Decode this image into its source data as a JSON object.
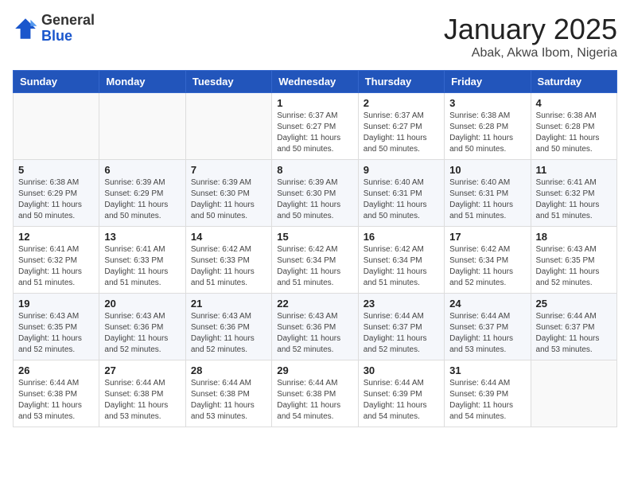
{
  "header": {
    "logo_general": "General",
    "logo_blue": "Blue",
    "month_title": "January 2025",
    "location": "Abak, Akwa Ibom, Nigeria"
  },
  "weekdays": [
    "Sunday",
    "Monday",
    "Tuesday",
    "Wednesday",
    "Thursday",
    "Friday",
    "Saturday"
  ],
  "weeks": [
    [
      {
        "day": "",
        "sunrise": "",
        "sunset": "",
        "daylight": ""
      },
      {
        "day": "",
        "sunrise": "",
        "sunset": "",
        "daylight": ""
      },
      {
        "day": "",
        "sunrise": "",
        "sunset": "",
        "daylight": ""
      },
      {
        "day": "1",
        "sunrise": "Sunrise: 6:37 AM",
        "sunset": "Sunset: 6:27 PM",
        "daylight": "Daylight: 11 hours and 50 minutes."
      },
      {
        "day": "2",
        "sunrise": "Sunrise: 6:37 AM",
        "sunset": "Sunset: 6:27 PM",
        "daylight": "Daylight: 11 hours and 50 minutes."
      },
      {
        "day": "3",
        "sunrise": "Sunrise: 6:38 AM",
        "sunset": "Sunset: 6:28 PM",
        "daylight": "Daylight: 11 hours and 50 minutes."
      },
      {
        "day": "4",
        "sunrise": "Sunrise: 6:38 AM",
        "sunset": "Sunset: 6:28 PM",
        "daylight": "Daylight: 11 hours and 50 minutes."
      }
    ],
    [
      {
        "day": "5",
        "sunrise": "Sunrise: 6:38 AM",
        "sunset": "Sunset: 6:29 PM",
        "daylight": "Daylight: 11 hours and 50 minutes."
      },
      {
        "day": "6",
        "sunrise": "Sunrise: 6:39 AM",
        "sunset": "Sunset: 6:29 PM",
        "daylight": "Daylight: 11 hours and 50 minutes."
      },
      {
        "day": "7",
        "sunrise": "Sunrise: 6:39 AM",
        "sunset": "Sunset: 6:30 PM",
        "daylight": "Daylight: 11 hours and 50 minutes."
      },
      {
        "day": "8",
        "sunrise": "Sunrise: 6:39 AM",
        "sunset": "Sunset: 6:30 PM",
        "daylight": "Daylight: 11 hours and 50 minutes."
      },
      {
        "day": "9",
        "sunrise": "Sunrise: 6:40 AM",
        "sunset": "Sunset: 6:31 PM",
        "daylight": "Daylight: 11 hours and 50 minutes."
      },
      {
        "day": "10",
        "sunrise": "Sunrise: 6:40 AM",
        "sunset": "Sunset: 6:31 PM",
        "daylight": "Daylight: 11 hours and 51 minutes."
      },
      {
        "day": "11",
        "sunrise": "Sunrise: 6:41 AM",
        "sunset": "Sunset: 6:32 PM",
        "daylight": "Daylight: 11 hours and 51 minutes."
      }
    ],
    [
      {
        "day": "12",
        "sunrise": "Sunrise: 6:41 AM",
        "sunset": "Sunset: 6:32 PM",
        "daylight": "Daylight: 11 hours and 51 minutes."
      },
      {
        "day": "13",
        "sunrise": "Sunrise: 6:41 AM",
        "sunset": "Sunset: 6:33 PM",
        "daylight": "Daylight: 11 hours and 51 minutes."
      },
      {
        "day": "14",
        "sunrise": "Sunrise: 6:42 AM",
        "sunset": "Sunset: 6:33 PM",
        "daylight": "Daylight: 11 hours and 51 minutes."
      },
      {
        "day": "15",
        "sunrise": "Sunrise: 6:42 AM",
        "sunset": "Sunset: 6:34 PM",
        "daylight": "Daylight: 11 hours and 51 minutes."
      },
      {
        "day": "16",
        "sunrise": "Sunrise: 6:42 AM",
        "sunset": "Sunset: 6:34 PM",
        "daylight": "Daylight: 11 hours and 51 minutes."
      },
      {
        "day": "17",
        "sunrise": "Sunrise: 6:42 AM",
        "sunset": "Sunset: 6:34 PM",
        "daylight": "Daylight: 11 hours and 52 minutes."
      },
      {
        "day": "18",
        "sunrise": "Sunrise: 6:43 AM",
        "sunset": "Sunset: 6:35 PM",
        "daylight": "Daylight: 11 hours and 52 minutes."
      }
    ],
    [
      {
        "day": "19",
        "sunrise": "Sunrise: 6:43 AM",
        "sunset": "Sunset: 6:35 PM",
        "daylight": "Daylight: 11 hours and 52 minutes."
      },
      {
        "day": "20",
        "sunrise": "Sunrise: 6:43 AM",
        "sunset": "Sunset: 6:36 PM",
        "daylight": "Daylight: 11 hours and 52 minutes."
      },
      {
        "day": "21",
        "sunrise": "Sunrise: 6:43 AM",
        "sunset": "Sunset: 6:36 PM",
        "daylight": "Daylight: 11 hours and 52 minutes."
      },
      {
        "day": "22",
        "sunrise": "Sunrise: 6:43 AM",
        "sunset": "Sunset: 6:36 PM",
        "daylight": "Daylight: 11 hours and 52 minutes."
      },
      {
        "day": "23",
        "sunrise": "Sunrise: 6:44 AM",
        "sunset": "Sunset: 6:37 PM",
        "daylight": "Daylight: 11 hours and 52 minutes."
      },
      {
        "day": "24",
        "sunrise": "Sunrise: 6:44 AM",
        "sunset": "Sunset: 6:37 PM",
        "daylight": "Daylight: 11 hours and 53 minutes."
      },
      {
        "day": "25",
        "sunrise": "Sunrise: 6:44 AM",
        "sunset": "Sunset: 6:37 PM",
        "daylight": "Daylight: 11 hours and 53 minutes."
      }
    ],
    [
      {
        "day": "26",
        "sunrise": "Sunrise: 6:44 AM",
        "sunset": "Sunset: 6:38 PM",
        "daylight": "Daylight: 11 hours and 53 minutes."
      },
      {
        "day": "27",
        "sunrise": "Sunrise: 6:44 AM",
        "sunset": "Sunset: 6:38 PM",
        "daylight": "Daylight: 11 hours and 53 minutes."
      },
      {
        "day": "28",
        "sunrise": "Sunrise: 6:44 AM",
        "sunset": "Sunset: 6:38 PM",
        "daylight": "Daylight: 11 hours and 53 minutes."
      },
      {
        "day": "29",
        "sunrise": "Sunrise: 6:44 AM",
        "sunset": "Sunset: 6:38 PM",
        "daylight": "Daylight: 11 hours and 54 minutes."
      },
      {
        "day": "30",
        "sunrise": "Sunrise: 6:44 AM",
        "sunset": "Sunset: 6:39 PM",
        "daylight": "Daylight: 11 hours and 54 minutes."
      },
      {
        "day": "31",
        "sunrise": "Sunrise: 6:44 AM",
        "sunset": "Sunset: 6:39 PM",
        "daylight": "Daylight: 11 hours and 54 minutes."
      },
      {
        "day": "",
        "sunrise": "",
        "sunset": "",
        "daylight": ""
      }
    ]
  ]
}
